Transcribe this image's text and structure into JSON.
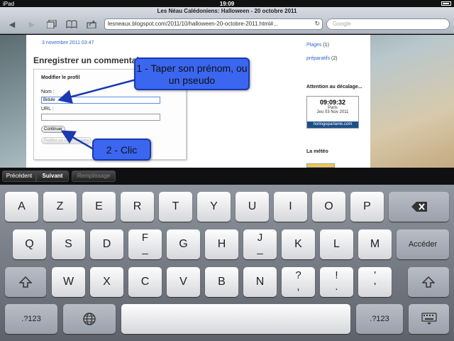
{
  "status_bar": {
    "carrier": "iPad",
    "time": "19:09",
    "battery": ""
  },
  "browser": {
    "page_title": "Les Néau Calédoniens: Halloween - 20 octobre 2011",
    "url": "lesneaux.blogspot.com/2011/10/halloween-20-octobre-2011.html#...",
    "search_placeholder": "Google"
  },
  "page": {
    "post_date": "3 novembre 2011 03:47",
    "section_title": "Enregistrer un commentaire",
    "form": {
      "legend": "Modifier le profil",
      "name_label": "Nom :",
      "name_value": "Bidule",
      "url_label": "URL :",
      "url_value": "",
      "continue_label": "Continuer",
      "publish_label": "Publier un commentaire"
    },
    "sidebar": {
      "links": [
        {
          "label": "Plages",
          "count": "(1)"
        },
        {
          "label": "préparatifs",
          "count": "(2)"
        }
      ],
      "clock_heading": "Attention au décalage...",
      "clock": {
        "time": "09:09:32",
        "city": "Paris",
        "date": "Jeu 03 Nov 2011",
        "brand": "horlogeparlante.com"
      },
      "meteo_heading": "La météo",
      "meteo_widget": "Météo Paris"
    }
  },
  "annotations": {
    "callout_1": "1 - Taper son prénom, ou un pseudo",
    "callout_2": "2 - Clic"
  },
  "form_assistant": {
    "previous": "Précédent",
    "next": "Suivant",
    "autofill": "Remplissage"
  },
  "keyboard": {
    "row1": [
      "A",
      "Z",
      "E",
      "R",
      "T",
      "Y",
      "U",
      "I",
      "O",
      "P"
    ],
    "row2": [
      "Q",
      "S",
      "D",
      "F",
      "G",
      "H",
      "J",
      "K",
      "L",
      "M"
    ],
    "row3": [
      "W",
      "X",
      "C",
      "V",
      "B",
      "N"
    ],
    "row3_punct": [
      {
        "top": "?",
        "bot": ","
      },
      {
        "top": "!",
        "bot": "."
      },
      {
        "top": "'",
        "bot": "'"
      }
    ],
    "row2_sub": {
      "F": "_",
      "J": "_"
    },
    "enter_label": "Accéder",
    "numbers_label": ".?123",
    "backspace_icon": "backspace-icon",
    "shift_icon": "shift-icon",
    "globe_icon": "globe-icon",
    "hide_keyboard_icon": "keyboard-dismiss-icon"
  }
}
